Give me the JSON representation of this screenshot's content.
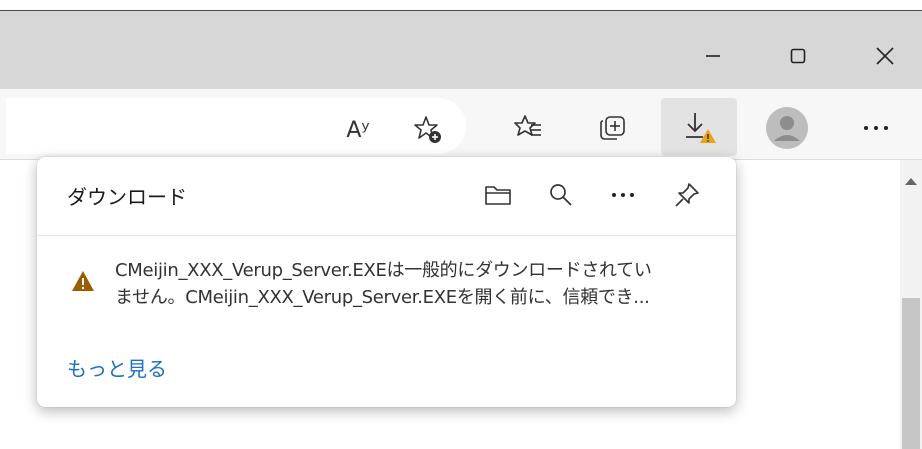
{
  "window": {
    "minimize_icon": "minimize-icon",
    "maximize_icon": "maximize-icon",
    "close_icon": "close-icon"
  },
  "toolbar": {
    "icons": [
      "read-aloud-icon",
      "add-favorite-icon",
      "favorites-icon",
      "collections-icon",
      "downloads-warning-icon",
      "profile-avatar",
      "more-options-icon"
    ],
    "read_aloud_glyph": "Aʸ"
  },
  "downloads": {
    "title": "ダウンロード",
    "header_icons": [
      "open-folder-icon",
      "search-icon",
      "more-icon",
      "pin-icon"
    ],
    "item": {
      "status_icon": "warning-icon",
      "line1": "CMeijin_XXX_Verup_Server.EXEは一般的にダウンロードされてい",
      "line2": "ません。CMeijin_XXX_Verup_Server.EXEを開く前に、信頼でき..."
    },
    "more_link": "もっと見る"
  },
  "colors": {
    "titlebar": "#d7d7d7",
    "toolbar": "#f7f7f7",
    "link": "#1a6fc6",
    "warning": "#9c5d00"
  }
}
